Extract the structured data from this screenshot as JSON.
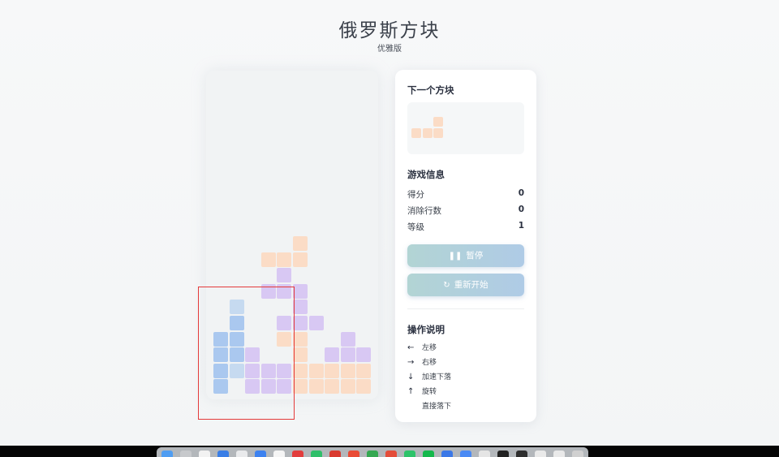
{
  "page": {
    "title": "俄罗斯方块",
    "subtitle": "优雅版"
  },
  "colors": {
    "orange": "#fbdcc6",
    "purple": "#d8c8f3",
    "blue": "#aac8ef",
    "blue_light": "#c6daf0",
    "button": "#b0d0e0"
  },
  "board": {
    "cols": 10,
    "rows": 20,
    "cells": [
      {
        "c": 5,
        "r": 10,
        "color": "orange"
      },
      {
        "c": 3,
        "r": 11,
        "color": "orange"
      },
      {
        "c": 4,
        "r": 11,
        "color": "orange"
      },
      {
        "c": 5,
        "r": 11,
        "color": "orange"
      },
      {
        "c": 4,
        "r": 12,
        "color": "purple"
      },
      {
        "c": 3,
        "r": 13,
        "color": "purple"
      },
      {
        "c": 4,
        "r": 13,
        "color": "purple"
      },
      {
        "c": 5,
        "r": 13,
        "color": "purple"
      },
      {
        "c": 1,
        "r": 14,
        "color": "blue_light"
      },
      {
        "c": 5,
        "r": 14,
        "color": "purple"
      },
      {
        "c": 1,
        "r": 15,
        "color": "blue"
      },
      {
        "c": 4,
        "r": 15,
        "color": "purple"
      },
      {
        "c": 5,
        "r": 15,
        "color": "purple"
      },
      {
        "c": 6,
        "r": 15,
        "color": "purple"
      },
      {
        "c": 0,
        "r": 16,
        "color": "blue"
      },
      {
        "c": 1,
        "r": 16,
        "color": "blue"
      },
      {
        "c": 4,
        "r": 16,
        "color": "orange"
      },
      {
        "c": 5,
        "r": 16,
        "color": "orange"
      },
      {
        "c": 8,
        "r": 16,
        "color": "purple"
      },
      {
        "c": 0,
        "r": 17,
        "color": "blue"
      },
      {
        "c": 1,
        "r": 17,
        "color": "blue"
      },
      {
        "c": 2,
        "r": 17,
        "color": "purple"
      },
      {
        "c": 5,
        "r": 17,
        "color": "orange"
      },
      {
        "c": 7,
        "r": 17,
        "color": "purple"
      },
      {
        "c": 8,
        "r": 17,
        "color": "purple"
      },
      {
        "c": 9,
        "r": 17,
        "color": "purple"
      },
      {
        "c": 0,
        "r": 18,
        "color": "blue"
      },
      {
        "c": 1,
        "r": 18,
        "color": "blue_light"
      },
      {
        "c": 2,
        "r": 18,
        "color": "purple"
      },
      {
        "c": 3,
        "r": 18,
        "color": "purple"
      },
      {
        "c": 4,
        "r": 18,
        "color": "purple"
      },
      {
        "c": 5,
        "r": 18,
        "color": "orange"
      },
      {
        "c": 6,
        "r": 18,
        "color": "orange"
      },
      {
        "c": 7,
        "r": 18,
        "color": "orange"
      },
      {
        "c": 8,
        "r": 18,
        "color": "orange"
      },
      {
        "c": 9,
        "r": 18,
        "color": "orange"
      },
      {
        "c": 0,
        "r": 19,
        "color": "blue"
      },
      {
        "c": 2,
        "r": 19,
        "color": "purple"
      },
      {
        "c": 3,
        "r": 19,
        "color": "purple"
      },
      {
        "c": 4,
        "r": 19,
        "color": "purple"
      },
      {
        "c": 5,
        "r": 19,
        "color": "orange"
      },
      {
        "c": 6,
        "r": 19,
        "color": "orange"
      },
      {
        "c": 7,
        "r": 19,
        "color": "orange"
      },
      {
        "c": 8,
        "r": 19,
        "color": "orange"
      },
      {
        "c": 9,
        "r": 19,
        "color": "orange"
      }
    ]
  },
  "next_piece": {
    "title": "下一个方块",
    "color": "orange",
    "cells": [
      {
        "c": 2,
        "r": 0
      },
      {
        "c": 0,
        "r": 1
      },
      {
        "c": 1,
        "r": 1
      },
      {
        "c": 2,
        "r": 1
      }
    ]
  },
  "info": {
    "title": "游戏信息",
    "stats": [
      {
        "label": "得分",
        "value": "0"
      },
      {
        "label": "消除行数",
        "value": "0"
      },
      {
        "label": "等级",
        "value": "1"
      }
    ]
  },
  "buttons": {
    "pause": {
      "icon": "pause-icon",
      "glyph": "❚❚",
      "label": "暂停"
    },
    "restart": {
      "icon": "restart-icon",
      "glyph": "↻",
      "label": "重新开始"
    }
  },
  "controls": {
    "title": "操作说明",
    "items": [
      {
        "icon": "arrow-left-icon",
        "glyph": "←",
        "label": "左移"
      },
      {
        "icon": "arrow-right-icon",
        "glyph": "→",
        "label": "右移"
      },
      {
        "icon": "arrow-down-icon",
        "glyph": "↓",
        "label": "加速下落"
      },
      {
        "icon": "arrow-up-icon",
        "glyph": "↑",
        "label": "旋转"
      },
      {
        "icon": "space-key-icon",
        "glyph": "",
        "label": "直接落下"
      }
    ]
  },
  "dock": {
    "icons": [
      "#4f9df2",
      "#c7c9cc",
      "#f2f2f2",
      "#3a7ee6",
      "#e9eaec",
      "#3d82f0",
      "#f5f5f5",
      "#e23d3d",
      "#2fbf6a",
      "#d93a2f",
      "#e94b35",
      "#35a852",
      "#e44d3a",
      "#2dc36a",
      "#14b84c",
      "#3b78e7",
      "#4a8af4",
      "#e5e5e5",
      "#222222",
      "#2e2e2e",
      "#e9e9e9",
      "#e9e9e9",
      "#d0d0d0"
    ]
  }
}
